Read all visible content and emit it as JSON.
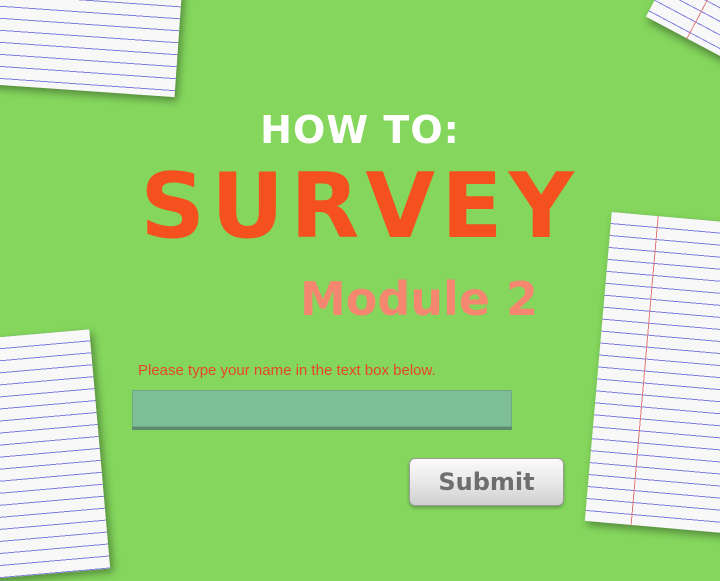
{
  "slide": {
    "heading": "HOW TO:",
    "title": "SURVEY",
    "subtitle": "Module 2"
  },
  "form": {
    "prompt": "Please type your name in the text box below.",
    "name_value": "",
    "submit_label": "Submit"
  },
  "colors": {
    "background": "#84d65d",
    "title": "#f4511e",
    "subtitle": "#f58771",
    "prompt": "#e8462b",
    "input_fill": "#7fbf98"
  }
}
